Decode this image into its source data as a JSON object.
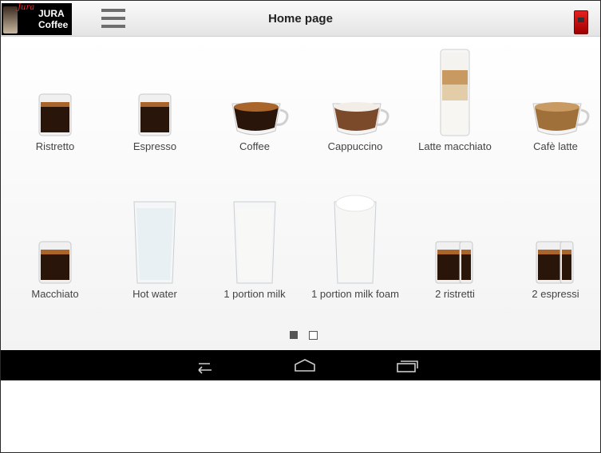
{
  "app": {
    "logo_script": "Jura",
    "logo_line1": "JURA",
    "logo_line2": "Coffee",
    "title": "Home page"
  },
  "products": [
    {
      "name": "Ristretto",
      "kind": "small-glass",
      "fill": "dark"
    },
    {
      "name": "Espresso",
      "kind": "small-glass",
      "fill": "dark"
    },
    {
      "name": "Coffee",
      "kind": "cup",
      "fill": "dark"
    },
    {
      "name": "Cappuccino",
      "kind": "cup",
      "fill": "foam"
    },
    {
      "name": "Latte macchiato",
      "kind": "tall-layered",
      "fill": "latte"
    },
    {
      "name": "Cafè latte",
      "kind": "cup",
      "fill": "latte"
    },
    {
      "name": "Macchiato",
      "kind": "small-glass",
      "fill": "dark"
    },
    {
      "name": "Hot water",
      "kind": "tall-glass",
      "fill": "water"
    },
    {
      "name": "1 portion milk",
      "kind": "tall-glass",
      "fill": "milk"
    },
    {
      "name": "1 portion milk foam",
      "kind": "tall-glass",
      "fill": "foam-milk"
    },
    {
      "name": "2 ristretti",
      "kind": "double-glass",
      "fill": "dark"
    },
    {
      "name": "2 espressi",
      "kind": "double-glass",
      "fill": "dark"
    }
  ],
  "pager": {
    "pages": 2,
    "current": 1
  },
  "colors": {
    "appbar": "#ececec",
    "navbar": "#000000",
    "brand_red": "#e62020"
  },
  "icons": {
    "menu": "hamburger-icon",
    "machine": "coffee-machine-icon",
    "back": "back-icon",
    "home": "home-icon",
    "recents": "recents-icon"
  }
}
